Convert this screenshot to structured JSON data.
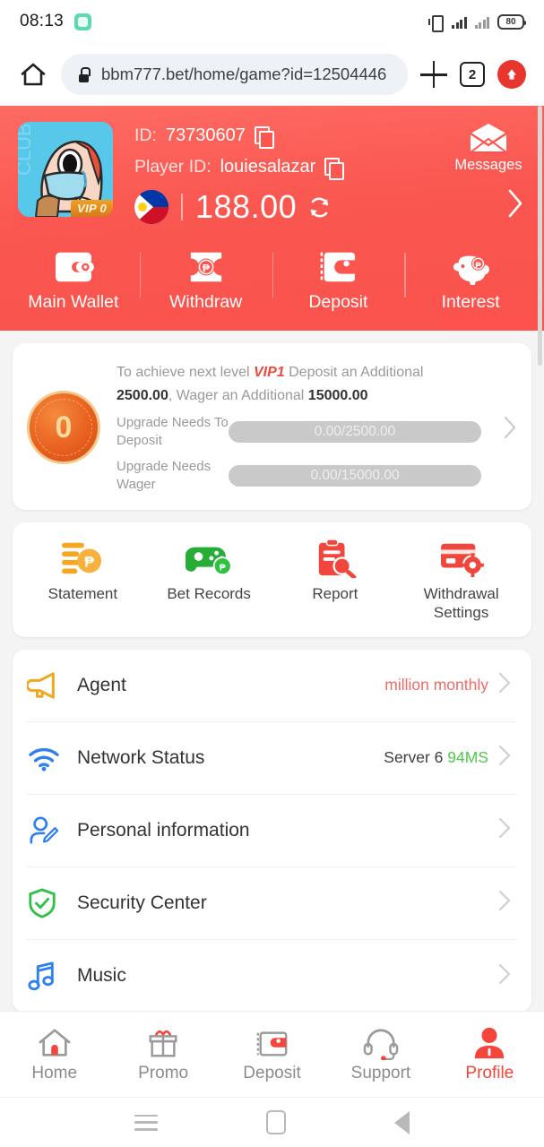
{
  "status_bar": {
    "time": "08:13",
    "app_icon": "rounded-square-icon",
    "vibrate_icon": "vibrate-icon",
    "signal_icon": "signal-bars-icon",
    "signal2_icon": "signal-bars-icon",
    "battery_level": "80"
  },
  "browser": {
    "home_icon": "home-icon",
    "lock_icon": "lock-icon",
    "url": "bbm777.bet/home/game?id=12504446",
    "new_tab_icon": "plus-icon",
    "tab_count": "2",
    "menu_icon": "opera-menu-icon"
  },
  "header": {
    "avatar_alt": "user-avatar",
    "vip_badge": "VIP 0",
    "id_label": "ID:",
    "id_value": "73730607",
    "player_id_label": "Player ID:",
    "player_id_value": "louiesalazar",
    "currency_flag": "philippines-flag",
    "balance": "188.00",
    "refresh_icon": "refresh-icon",
    "messages_icon": "envelope-icon",
    "messages_label": "Messages",
    "chevron_icon": "chevron-right-icon",
    "accent_color": "#fa564f",
    "wallet_actions": [
      {
        "label": "Main Wallet",
        "icon": "wallet-icon"
      },
      {
        "label": "Withdraw",
        "icon": "withdraw-ticket-icon"
      },
      {
        "label": "Deposit",
        "icon": "deposit-wallet-icon"
      },
      {
        "label": "Interest",
        "icon": "piggy-bank-icon"
      }
    ]
  },
  "vip_card": {
    "medal_level": "0",
    "text_prefix": "To achieve next level ",
    "next_level": "VIP1",
    "text_mid": " Deposit an Additional ",
    "deposit_needed": "2500.00",
    "text_mid2": ", Wager an Additional ",
    "wager_needed": "15000.00",
    "deposit_progress_label": "Upgrade Needs To Deposit",
    "deposit_progress_value": "0.00/2500.00",
    "wager_progress_label": "Upgrade Needs Wager",
    "wager_progress_value": "0.00/15000.00",
    "chevron_icon": "chevron-right-icon"
  },
  "quick_actions": [
    {
      "label": "Statement",
      "icon": "statement-coins-icon",
      "color": "#f5a623"
    },
    {
      "label": "Bet Records",
      "icon": "gamepad-icon",
      "color": "#25ad36"
    },
    {
      "label": "Report",
      "icon": "report-search-icon",
      "color": "#f0463c"
    },
    {
      "label": "Withdrawal Settings",
      "icon": "card-settings-icon",
      "color": "#f0463c"
    }
  ],
  "menu_items": [
    {
      "label": "Agent",
      "icon": "megaphone-icon",
      "value": "million monthly",
      "value_style": "agent"
    },
    {
      "label": "Network Status",
      "icon": "wifi-icon",
      "server": "Server 6",
      "latency": "94MS",
      "value_style": "server"
    },
    {
      "label": "Personal information",
      "icon": "user-edit-icon",
      "value": "",
      "value_style": ""
    },
    {
      "label": "Security Center",
      "icon": "shield-check-icon",
      "value": "",
      "value_style": ""
    },
    {
      "label": "Music",
      "icon": "music-note-icon",
      "value": "",
      "value_style": ""
    }
  ],
  "bottom_nav": [
    {
      "label": "Home",
      "icon": "home-icon",
      "active": false
    },
    {
      "label": "Promo",
      "icon": "gift-icon",
      "active": false
    },
    {
      "label": "Deposit",
      "icon": "wallet-icon",
      "active": false
    },
    {
      "label": "Support",
      "icon": "headset-icon",
      "active": false
    },
    {
      "label": "Profile",
      "icon": "person-icon",
      "active": true
    }
  ],
  "android_nav": {
    "recent_icon": "recent-apps-icon",
    "home_icon": "home-square-icon",
    "back_icon": "back-triangle-icon"
  }
}
